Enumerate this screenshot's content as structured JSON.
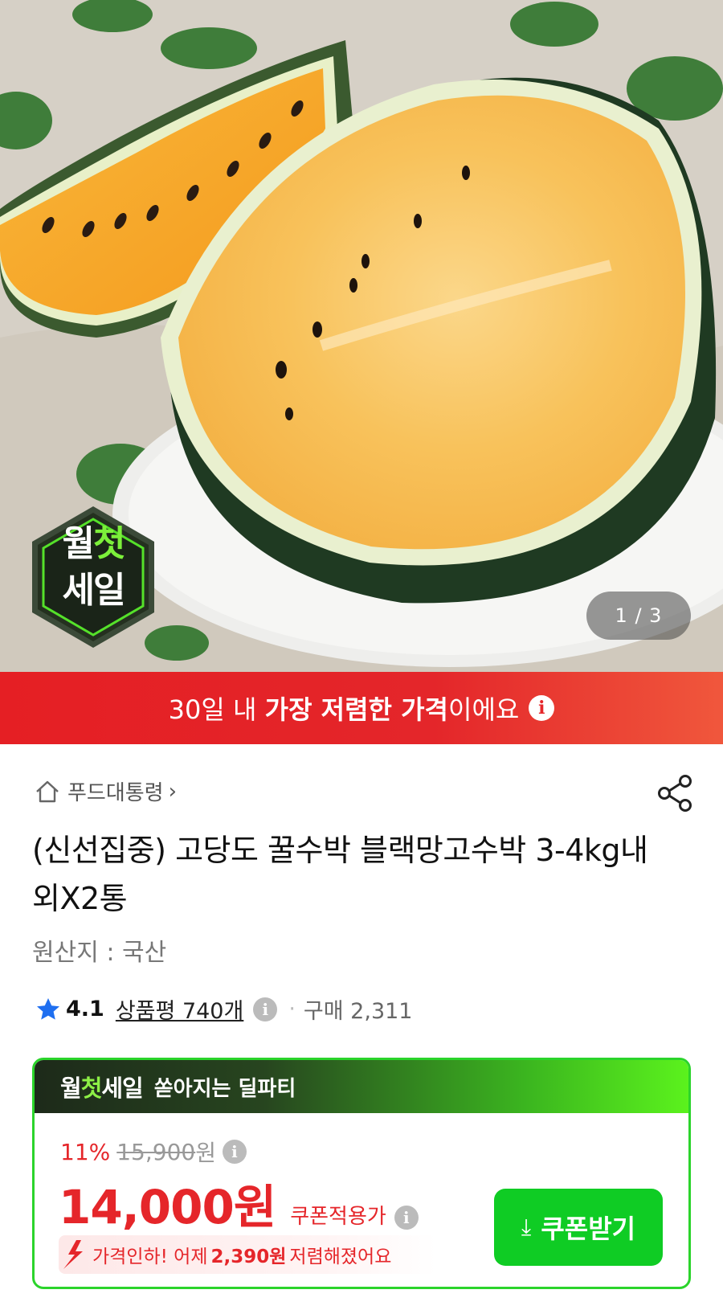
{
  "hero": {
    "counter": "1 / 3",
    "badge_line1_a": "월",
    "badge_line1_b": "첫",
    "badge_line2": "세일"
  },
  "banner": {
    "prefix": "30일 내 ",
    "strong": "가장 저렴한 가격",
    "suffix": "이에요",
    "info_icon": "i"
  },
  "product": {
    "breadcrumb": "푸드대통령",
    "title": "(신선집중) 고당도 꿀수박 블랙망고수박 3-4kg내외X2통",
    "origin": "원산지 : 국산",
    "rating": "4.1",
    "reviews": "상품평 740개",
    "purchases": "구매 2,311"
  },
  "deal": {
    "brand_a": "월",
    "brand_b": "첫",
    "brand_c": "세일",
    "headline": "쏟아지는 딜파티",
    "discount_pct": "11%",
    "original_price": "15,900",
    "original_unit": "원",
    "price": "14,000원",
    "price_label": "쿠폰적용가",
    "drop_prefix": "가격인하! 어제",
    "drop_amount": "2,390원",
    "drop_suffix": "저렴해졌어요",
    "coupon_button": "쿠폰받기"
  },
  "colors": {
    "accent_red": "#e5262a",
    "deal_green": "#0fcc24",
    "star_blue": "#1f6ff0"
  },
  "icons": [
    "home-icon",
    "chevron-right-icon",
    "share-icon",
    "star-icon",
    "info-icon",
    "download-icon",
    "price-down-arrow-icon"
  ]
}
